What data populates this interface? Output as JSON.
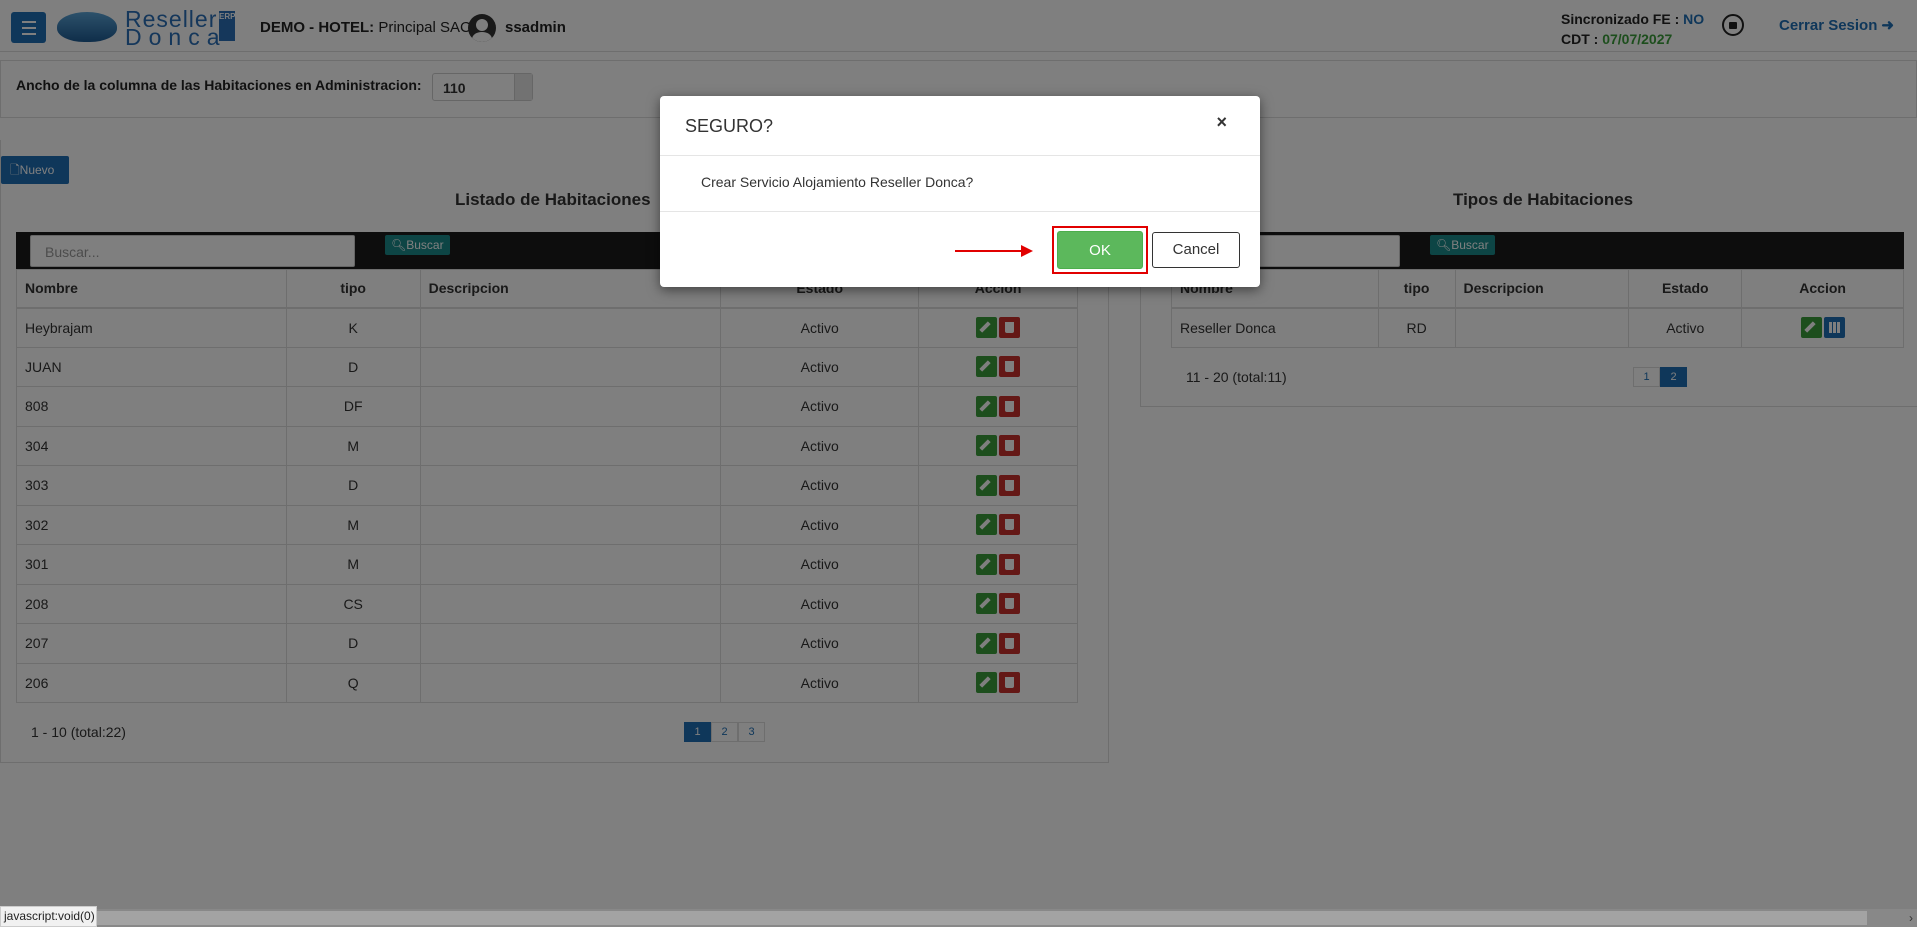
{
  "header": {
    "logo_line1": "Reseller",
    "logo_line2": "Donca",
    "logo_badge": "ERP",
    "hotel_label": "DEMO - HOTEL:",
    "hotel_name": " Principal SAC |",
    "username": "ssadmin",
    "sync_label": "Sincronizado FE : ",
    "sync_value": "NO",
    "cdt_label": "CDT : ",
    "cdt_value": "07/07/2027",
    "logout_label": "Cerrar Sesion",
    "logout_icon": "sign-out-icon"
  },
  "config": {
    "label": "Ancho de la columna de las Habitaciones en Administracion:",
    "value": "110"
  },
  "new_button": "Nuevo",
  "rooms": {
    "title": "Listado de Habitaciones",
    "search_placeholder": "Buscar...",
    "search_button": "Buscar",
    "columns": [
      "Nombre",
      "tipo",
      "Descripcion",
      "Estado",
      "Accion"
    ],
    "rows": [
      {
        "nombre": "Heybrajam",
        "tipo": "K",
        "descripcion": "",
        "estado": "Activo"
      },
      {
        "nombre": "JUAN",
        "tipo": "D",
        "descripcion": "",
        "estado": "Activo"
      },
      {
        "nombre": "808",
        "tipo": "DF",
        "descripcion": "",
        "estado": "Activo"
      },
      {
        "nombre": "304",
        "tipo": "M",
        "descripcion": "",
        "estado": "Activo"
      },
      {
        "nombre": "303",
        "tipo": "D",
        "descripcion": "",
        "estado": "Activo"
      },
      {
        "nombre": "302",
        "tipo": "M",
        "descripcion": "",
        "estado": "Activo"
      },
      {
        "nombre": "301",
        "tipo": "M",
        "descripcion": "",
        "estado": "Activo"
      },
      {
        "nombre": "208",
        "tipo": "CS",
        "descripcion": "",
        "estado": "Activo"
      },
      {
        "nombre": "207",
        "tipo": "D",
        "descripcion": "",
        "estado": "Activo"
      },
      {
        "nombre": "206",
        "tipo": "Q",
        "descripcion": "",
        "estado": "Activo"
      }
    ],
    "pager_info": "1 - 10 (total:22)",
    "pages": [
      "1",
      "2",
      "3"
    ],
    "active_page": "1"
  },
  "room_types": {
    "title": "Tipos de Habitaciones",
    "search_button": "Buscar",
    "columns": [
      "Nombre",
      "tipo",
      "Descripcion",
      "Estado",
      "Accion"
    ],
    "rows": [
      {
        "nombre": "Reseller Donca",
        "tipo": "RD",
        "descripcion": "",
        "estado": "Activo"
      }
    ],
    "pager_info": "11 - 20 (total:11)",
    "pages": [
      "1",
      "2"
    ],
    "active_page": "2"
  },
  "modal": {
    "title": "SEGURO?",
    "close": "×",
    "message": "Crear Servicio Alojamiento Reseller Donca?",
    "ok_label": "OK",
    "cancel_label": "Cancel",
    "highlight_color": "#e10000"
  },
  "statusbar": "javascript:void(0)",
  "colors": {
    "primary": "#1f6fb5",
    "success": "#5cb85c",
    "danger": "#c9302c",
    "teal": "#1a8a8a"
  }
}
